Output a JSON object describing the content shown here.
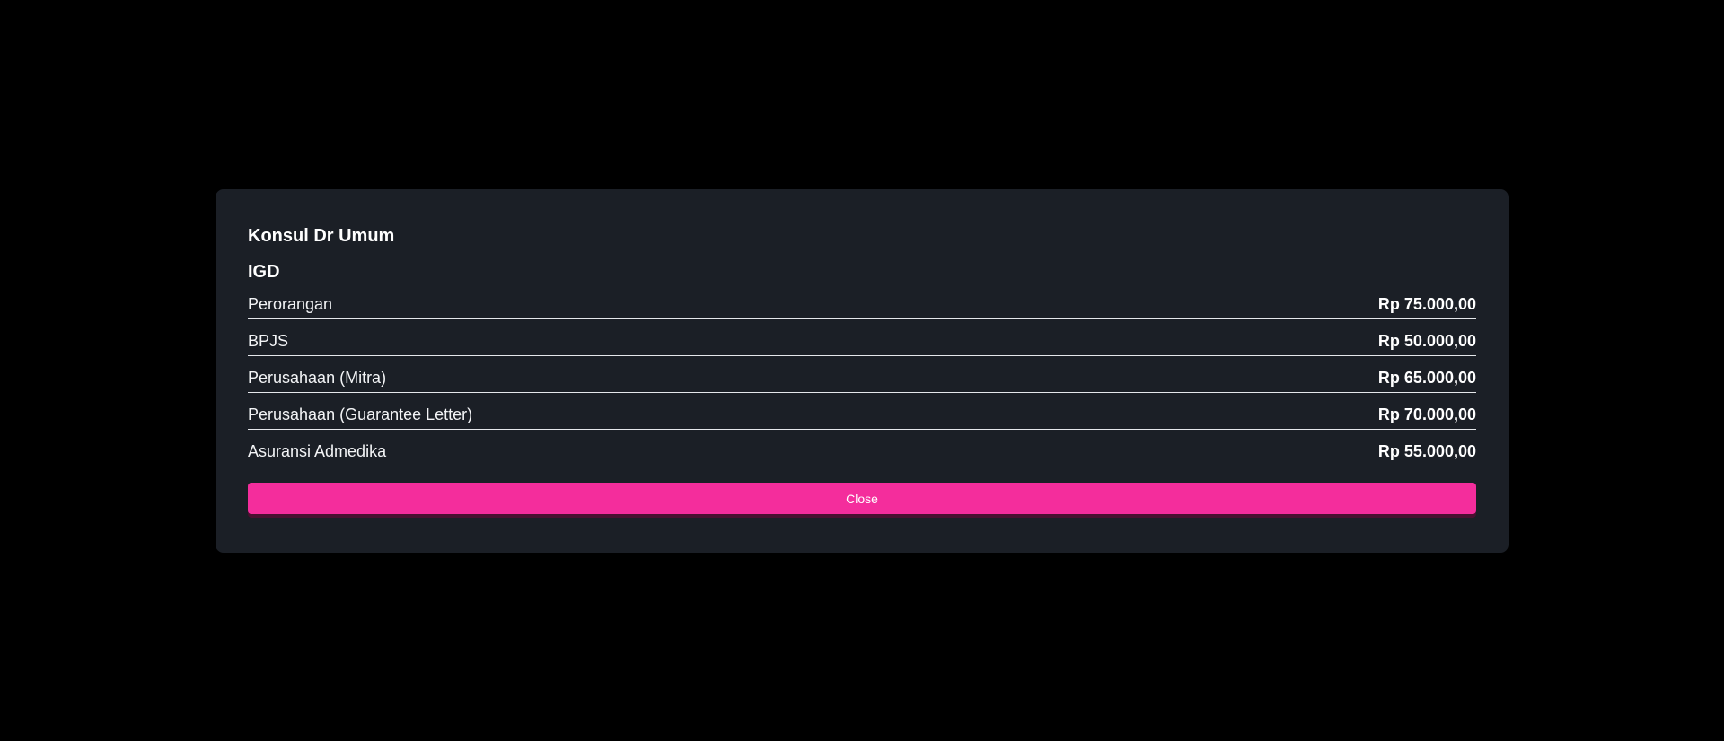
{
  "modal": {
    "title": "Konsul Dr Umum",
    "subtitle": "IGD",
    "items": [
      {
        "label": "Perorangan",
        "price": "Rp 75.000,00"
      },
      {
        "label": "BPJS",
        "price": "Rp 50.000,00"
      },
      {
        "label": "Perusahaan (Mitra)",
        "price": "Rp 65.000,00"
      },
      {
        "label": "Perusahaan (Guarantee Letter)",
        "price": "Rp 70.000,00"
      },
      {
        "label": "Asuransi Admedika",
        "price": "Rp 55.000,00"
      }
    ],
    "close_label": "Close"
  },
  "colors": {
    "backdrop": "#000000",
    "modal_bg": "#1b1f26",
    "accent": "#f42d9c",
    "text": "#ffffff",
    "divider": "#e5e7eb"
  }
}
